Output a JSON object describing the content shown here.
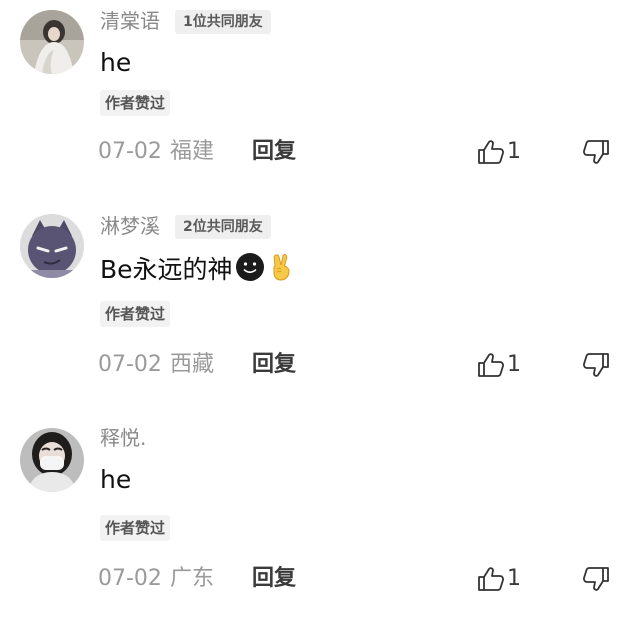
{
  "comments": [
    {
      "username": "清棠语",
      "mutual_friends": "1位共同朋友",
      "text": "he",
      "author_liked": "作者赞过",
      "date": "07-02",
      "location": "福建",
      "reply_label": "回复",
      "like_count": "1",
      "avatar": "girl-photo-avatar"
    },
    {
      "username": "淋梦溪",
      "mutual_friends": "2位共同朋友",
      "text": "Be永远的神",
      "emojis": [
        "dark-smiley-face-emoji",
        "victory-hand-emoji"
      ],
      "author_liked": "作者赞过",
      "date": "07-02",
      "location": "西藏",
      "reply_label": "回复",
      "like_count": "1",
      "avatar": "purple-cartoon-avatar"
    },
    {
      "username": "释悦.",
      "text": "he",
      "author_liked": "作者赞过",
      "date": "07-02",
      "location": "广东",
      "reply_label": "回复",
      "like_count": "1",
      "avatar": "masked-girl-photo-avatar"
    }
  ],
  "colors": {
    "username": "#8a8a8a",
    "text": "#111111",
    "meta": "#9a9a9a",
    "badge_bg": "#efefef"
  }
}
